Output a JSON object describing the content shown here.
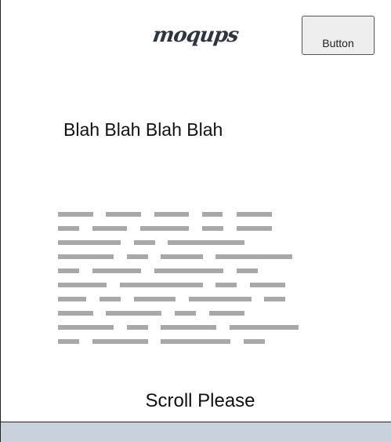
{
  "header": {
    "logo_text": "moqups",
    "button_label": "Button"
  },
  "main": {
    "heading_text": "Blah Blah Blah Blah",
    "footer_text": "Scroll Please"
  },
  "colors": {
    "placeholder_bar": "#a8a8a8",
    "bottom_strip": "#c9d2dc",
    "button_bg": "#eeeeee"
  }
}
